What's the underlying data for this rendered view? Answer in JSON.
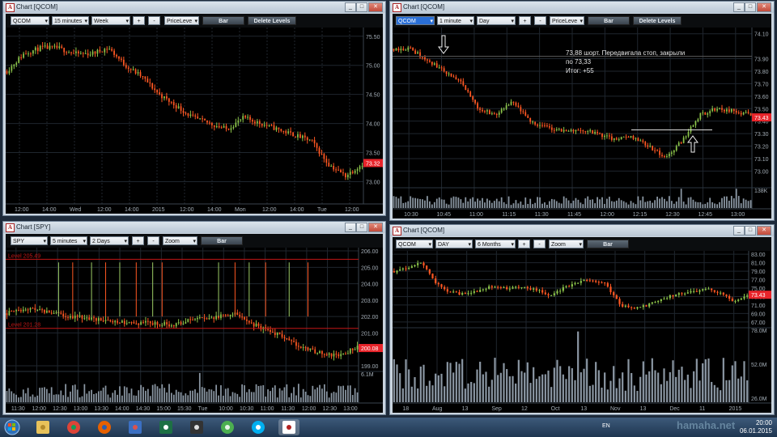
{
  "colors": {
    "up": "#8bc34a",
    "down": "#ff5722",
    "price_tag": "#e8242a",
    "level": "#c41616",
    "grid": "#1f262e",
    "axis_text": "#a3adb6"
  },
  "windows": [
    {
      "id": "w1",
      "title": "Chart [QCOM]",
      "toolbar": {
        "symbol": "QCOM",
        "interval": "15 minutes",
        "period": "Week",
        "plus": "+",
        "minus": "-",
        "mode": "PriceLeve",
        "type_btn": "Bar",
        "delete_btn": "Delete Levels"
      },
      "price_labels": [
        "75.50",
        "75.00",
        "74.50",
        "74.00",
        "73.50",
        "73.00"
      ],
      "current_price": "73.32",
      "time_labels": [
        "12:00",
        "14:00",
        "Wed",
        "12:00",
        "14:00",
        "2015",
        "12:00",
        "14:00",
        "Mon",
        "12:00",
        "14:00",
        "Tue",
        "12:00"
      ]
    },
    {
      "id": "w2",
      "title": "Chart [QCOM]",
      "toolbar": {
        "symbol": "QCOM",
        "interval": "1 minute",
        "period": "Day",
        "plus": "+",
        "minus": "-",
        "mode": "PriceLeve",
        "type_btn": "Bar",
        "delete_btn": "Delete Levels"
      },
      "price_labels": [
        "74.10",
        "73.90",
        "73.80",
        "73.70",
        "73.60",
        "73.50",
        "73.40",
        "73.30",
        "73.20",
        "73.10",
        "73.00"
      ],
      "current_price": "73.43",
      "volume_label": "138K",
      "time_labels": [
        "10:30",
        "10:45",
        "11:00",
        "11:15",
        "11:30",
        "11:45",
        "12:00",
        "12:15",
        "12:30",
        "12:45",
        "13:00"
      ],
      "note": [
        "73,88 шорт. Передвигала стоп, закрыли",
        "по 73,33",
        "Итог: +55"
      ]
    },
    {
      "id": "w3",
      "title": "Chart [SPY]",
      "toolbar": {
        "symbol": "SPY",
        "interval": "5 minutes",
        "period": "2 Days",
        "plus": "+",
        "minus": "-",
        "mode": "Zoom",
        "type_btn": "Bar"
      },
      "levels": [
        "Level 205.49",
        "Level 201.28"
      ],
      "price_labels": [
        "206.00",
        "205.00",
        "204.00",
        "203.00",
        "202.00",
        "201.00",
        "199.00"
      ],
      "current_price": "200.08",
      "volume_label": "6.1M",
      "time_labels": [
        "11:30",
        "12:00",
        "12:30",
        "13:00",
        "13:30",
        "14:00",
        "14:30",
        "15:00",
        "15:30",
        "Tue",
        "10:00",
        "10:30",
        "11:00",
        "11:30",
        "12:00",
        "12:30",
        "13:00"
      ]
    },
    {
      "id": "w4",
      "title": "Chart [QCOM]",
      "toolbar": {
        "symbol": "QCOM",
        "interval": "DAY",
        "period": "6 Months",
        "plus": "+",
        "minus": "-",
        "mode": "Zoom",
        "type_btn": "Bar"
      },
      "price_labels": [
        "83.00",
        "81.00",
        "79.00",
        "77.00",
        "75.00",
        "73.00",
        "71.00",
        "69.00",
        "67.00"
      ],
      "current_price": "73.43",
      "volume_labels": [
        "78.0M",
        "52.0M",
        "26.0M"
      ],
      "time_labels": [
        "18",
        "Aug",
        "13",
        "Sep",
        "12",
        "Oct",
        "13",
        "Nov",
        "13",
        "Dec",
        "11",
        "2015"
      ]
    }
  ],
  "taskbar": {
    "apps": [
      "explorer-folder",
      "chrome",
      "firefox",
      "save-disk",
      "excel",
      "movie-clapper",
      "utorrent",
      "skype",
      "atas-chart"
    ],
    "lang": "EN",
    "time": "20:00",
    "date": "06.01.2015"
  },
  "watermark": "hamaha.net"
}
